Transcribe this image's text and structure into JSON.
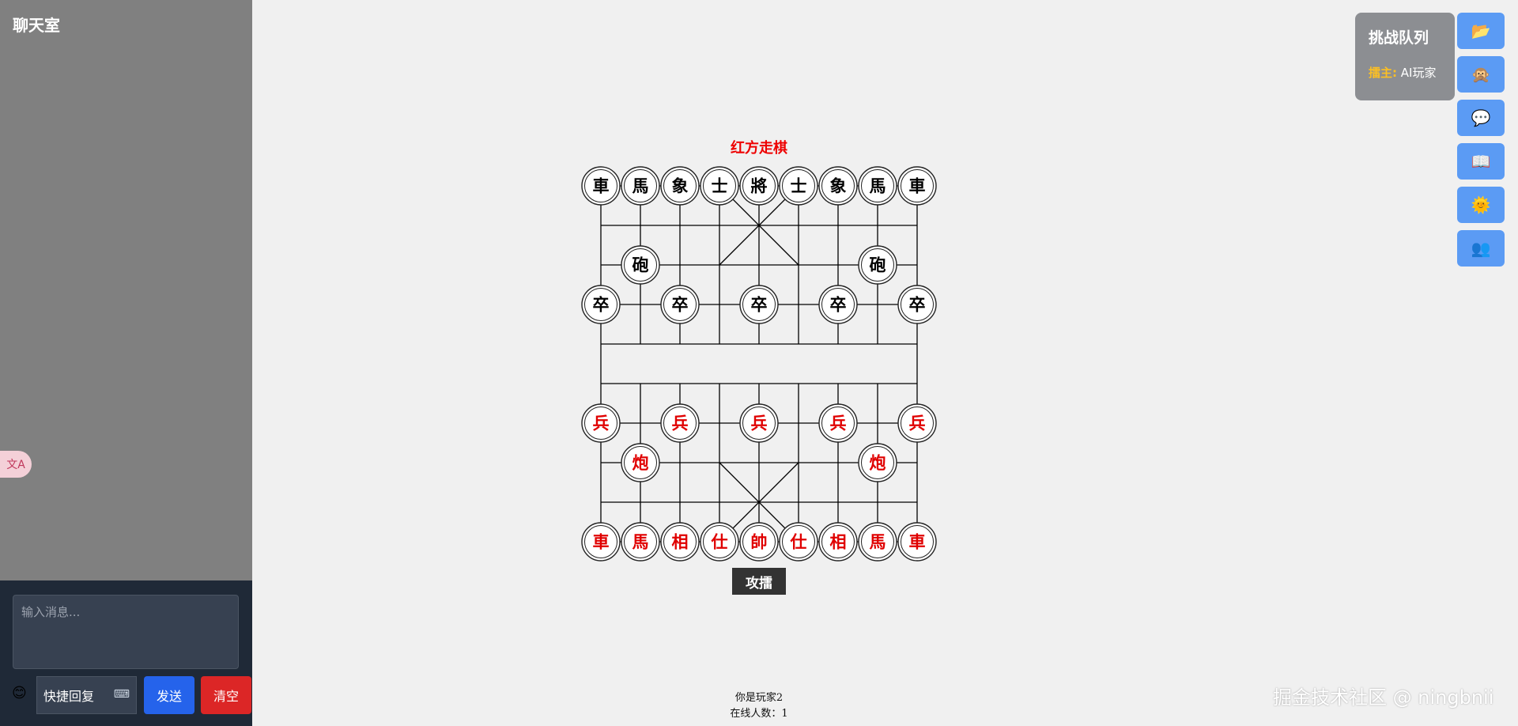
{
  "chat": {
    "title": "聊天室",
    "input_placeholder": "输入消息...",
    "emoji": "😊",
    "quick_reply_label": "快捷回复",
    "send_label": "发送",
    "clear_label": "清空",
    "translate_icon": "translate-icon"
  },
  "game": {
    "turn_status": "红方走棋",
    "challenge_button": "攻擂",
    "player_info": "你是玩家2",
    "online_count": "在线人数：1",
    "black_pieces": [
      {
        "name": "車",
        "col": 0,
        "row": 0
      },
      {
        "name": "馬",
        "col": 1,
        "row": 0
      },
      {
        "name": "象",
        "col": 2,
        "row": 0
      },
      {
        "name": "士",
        "col": 3,
        "row": 0
      },
      {
        "name": "將",
        "col": 4,
        "row": 0
      },
      {
        "name": "士",
        "col": 5,
        "row": 0
      },
      {
        "name": "象",
        "col": 6,
        "row": 0
      },
      {
        "name": "馬",
        "col": 7,
        "row": 0
      },
      {
        "name": "車",
        "col": 8,
        "row": 0
      },
      {
        "name": "砲",
        "col": 1,
        "row": 2
      },
      {
        "name": "砲",
        "col": 7,
        "row": 2
      },
      {
        "name": "卒",
        "col": 0,
        "row": 3
      },
      {
        "name": "卒",
        "col": 2,
        "row": 3
      },
      {
        "name": "卒",
        "col": 4,
        "row": 3
      },
      {
        "name": "卒",
        "col": 6,
        "row": 3
      },
      {
        "name": "卒",
        "col": 8,
        "row": 3
      }
    ],
    "red_pieces": [
      {
        "name": "兵",
        "col": 0,
        "row": 6
      },
      {
        "name": "兵",
        "col": 2,
        "row": 6
      },
      {
        "name": "兵",
        "col": 4,
        "row": 6
      },
      {
        "name": "兵",
        "col": 6,
        "row": 6
      },
      {
        "name": "兵",
        "col": 8,
        "row": 6
      },
      {
        "name": "炮",
        "col": 1,
        "row": 7
      },
      {
        "name": "炮",
        "col": 7,
        "row": 7
      },
      {
        "name": "車",
        "col": 0,
        "row": 9
      },
      {
        "name": "馬",
        "col": 1,
        "row": 9
      },
      {
        "name": "相",
        "col": 2,
        "row": 9
      },
      {
        "name": "仕",
        "col": 3,
        "row": 9
      },
      {
        "name": "帥",
        "col": 4,
        "row": 9
      },
      {
        "name": "仕",
        "col": 5,
        "row": 9
      },
      {
        "name": "相",
        "col": 6,
        "row": 9
      },
      {
        "name": "馬",
        "col": 7,
        "row": 9
      },
      {
        "name": "車",
        "col": 8,
        "row": 9
      }
    ],
    "black_color": "#000000",
    "red_color": "#e00000"
  },
  "queue": {
    "title": "挑战队列",
    "host_label": "擂主:",
    "host_name": "AI玩家"
  },
  "toolbar": [
    {
      "icon": "folder-icon",
      "glyph": "📂"
    },
    {
      "icon": "monkey-icon",
      "glyph": "🙊"
    },
    {
      "icon": "chat-bubble-icon",
      "glyph": "💬"
    },
    {
      "icon": "book-icon",
      "glyph": "📖"
    },
    {
      "icon": "sun-icon",
      "glyph": "🌞"
    },
    {
      "icon": "users-icon",
      "glyph": "👥"
    }
  ],
  "watermark": "掘金技术社区 @ ningbnii",
  "colors": {
    "sidebar": "#808080",
    "footer": "#1f2937",
    "send": "#2563eb",
    "clear": "#dc2626",
    "toolbar": "#5b9bf4",
    "queue_panel": "#8c8e92",
    "host_label": "#fbbf24"
  }
}
